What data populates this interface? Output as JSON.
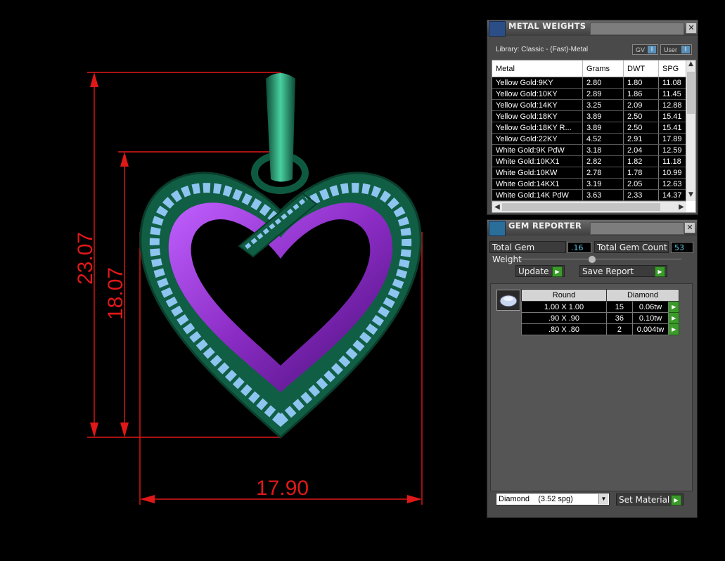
{
  "dimensions": {
    "height_outer": "23.07",
    "height_inner": "18.07",
    "width": "17.90"
  },
  "metal_weights": {
    "title": "METAL WEIGHTS",
    "library": "Library: Classic - (Fast)-Metal",
    "toggle_gv": "GV",
    "toggle_user": "User",
    "columns": [
      "Metal",
      "Grams",
      "DWT",
      "SPG"
    ],
    "rows": [
      [
        "Yellow Gold:9KY",
        "2.80",
        "1.80",
        "11.08"
      ],
      [
        "Yellow Gold:10KY",
        "2.89",
        "1.86",
        "11.45"
      ],
      [
        "Yellow Gold:14KY",
        "3.25",
        "2.09",
        "12.88"
      ],
      [
        "Yellow Gold:18KY",
        "3.89",
        "2.50",
        "15.41"
      ],
      [
        "Yellow Gold:18KY R...",
        "3.89",
        "2.50",
        "15.41"
      ],
      [
        "Yellow Gold:22KY",
        "4.52",
        "2.91",
        "17.89"
      ],
      [
        "White Gold:9K PdW",
        "3.18",
        "2.04",
        "12.59"
      ],
      [
        "White Gold:10KX1",
        "2.82",
        "1.82",
        "11.18"
      ],
      [
        "White Gold:10KW",
        "2.78",
        "1.78",
        "10.99"
      ],
      [
        "White Gold:14KX1",
        "3.19",
        "2.05",
        "12.63"
      ],
      [
        "White Gold:14K PdW",
        "3.63",
        "2.33",
        "14.37"
      ]
    ]
  },
  "gem_reporter": {
    "title": "GEM REPORTER",
    "total_weight_label": "Total Gem Weight",
    "total_weight_value": ".16",
    "total_count_label": "Total Gem Count",
    "total_count_value": "53",
    "update_label": "Update",
    "save_label": "Save Report",
    "header_shape": "Round",
    "header_material": "Diamond",
    "rows": [
      [
        "1.00 X 1.00",
        "15",
        "0.06tw"
      ],
      [
        ".90 X .90",
        "36",
        "0.10tw"
      ],
      [
        ".80 X .80",
        "2",
        "0.004tw"
      ]
    ],
    "material_select": "Diamond    (3.52 spg)",
    "set_material_label": "Set Material"
  },
  "colors": {
    "dimension": "#e01818",
    "pendant_metal": "#1f7a5a",
    "heart_inner": "#9a2fd0",
    "gems": "#8ec4f0"
  }
}
